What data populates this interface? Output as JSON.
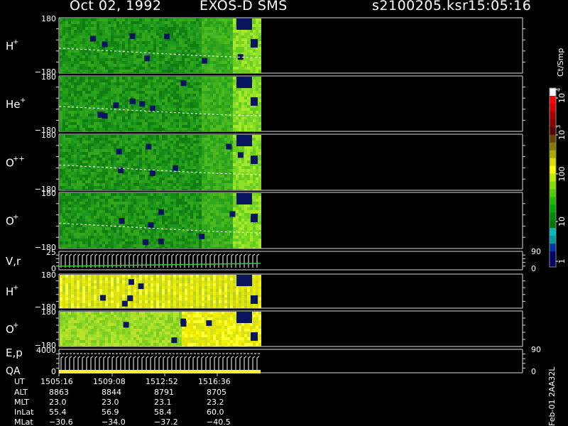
{
  "header": {
    "date": "Oct 02, 1992",
    "instrument": "EXOS-D SMS",
    "file": "s2100205.ksr",
    "time": "15:05:16"
  },
  "colorbar": {
    "unit": "Ct/Smp",
    "labels": [
      "1",
      "10",
      "100",
      "10",
      "10"
    ],
    "superscripts": [
      "",
      "",
      "",
      "3",
      "4"
    ],
    "colors": [
      "#000066",
      "#000066",
      "#0033aa",
      "#009999",
      "#00bbbb",
      "#007700",
      "#008800",
      "#00aa00",
      "#22bb00",
      "#55cc00",
      "#88dd00",
      "#bbee00",
      "#ffff00",
      "#dddd00",
      "#aaaa00",
      "#887700",
      "#664400",
      "#550000",
      "#880000",
      "#aa0000",
      "#dd0000",
      "#ff0000",
      "#ffffff"
    ]
  },
  "side_label": "Feb-01 2AA32L",
  "panels": [
    {
      "label": "H",
      "sup": "+",
      "ytop": "180",
      "ybot": "−180",
      "palette": "green"
    },
    {
      "label": "He",
      "sup": "+",
      "ytop": "180",
      "ybot": "−180",
      "palette": "green"
    },
    {
      "label": "O",
      "sup": "++",
      "ytop": "180",
      "ybot": "−180",
      "palette": "green"
    },
    {
      "label": "O",
      "sup": "+",
      "ytop": "180",
      "ybot": "−180",
      "palette": "green"
    },
    {
      "label": "V,r",
      "sup": "",
      "ytop": "25",
      "ybot": "0",
      "rtop": "90",
      "rbot": "0",
      "palette": "lines"
    },
    {
      "label": "H",
      "sup": "+",
      "ytop": "180",
      "ybot": "−180",
      "palette": "yellow"
    },
    {
      "label": "O",
      "sup": "+",
      "ytop": "180",
      "ybot": "−180",
      "palette": "yellowgreen"
    },
    {
      "label": "E,p",
      "label2": "QA",
      "sup": "",
      "ytop": "4000",
      "ybot": "0",
      "rtop": "90",
      "rbot": "0",
      "palette": "ep"
    }
  ],
  "time_axis": {
    "rows": [
      {
        "name": "UT",
        "values": [
          "1505:16",
          "1509:08",
          "1512:52",
          "1516:36"
        ]
      },
      {
        "name": "ALT",
        "values": [
          "8863",
          "8844",
          "8791",
          "8705"
        ]
      },
      {
        "name": "MLT",
        "values": [
          "23.0",
          "23.0",
          "23.1",
          "23.2"
        ]
      },
      {
        "name": "InLat",
        "values": [
          "55.4",
          "56.9",
          "58.4",
          "60.0"
        ]
      },
      {
        "name": "MLat",
        "values": [
          "−30.6",
          "−34.0",
          "−37.2",
          "−40.5"
        ]
      }
    ]
  },
  "chart_data": {
    "type": "heatmap",
    "title": "Oct 02, 1992   EXOS-D SMS",
    "colorscale_label": "Ct/Smp",
    "colorscale_ticks": [
      "1",
      "10",
      "100",
      "10^3",
      "10^4"
    ],
    "x_ticks": [
      "1505:16",
      "1509:08",
      "1512:52",
      "1516:36"
    ],
    "series": [
      {
        "name": "H+",
        "ylim": [
          -180,
          180
        ]
      },
      {
        "name": "He+",
        "ylim": [
          -180,
          180
        ]
      },
      {
        "name": "O++",
        "ylim": [
          -180,
          180
        ]
      },
      {
        "name": "O+",
        "ylim": [
          -180,
          180
        ]
      },
      {
        "name": "V,r",
        "ylim": [
          0,
          25
        ]
      },
      {
        "name": "H+",
        "ylim": [
          -180,
          180
        ]
      },
      {
        "name": "O+",
        "ylim": [
          -180,
          180
        ]
      },
      {
        "name": "E,p",
        "ylim": [
          0,
          4000
        ]
      }
    ]
  }
}
